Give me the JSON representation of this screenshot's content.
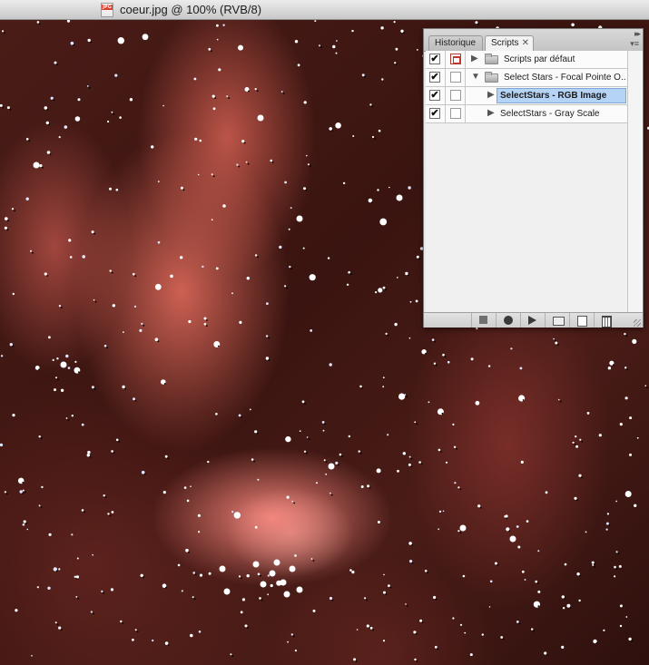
{
  "window": {
    "title": "coeur.jpg @ 100% (RVB/8)",
    "file_badge": "JPG"
  },
  "panel": {
    "tabs": [
      {
        "label": "Historique",
        "active": false
      },
      {
        "label": "Scripts",
        "active": true,
        "close_glyph": "✕"
      }
    ],
    "collapse_glyph": "▸▸",
    "menu_glyph": "▾≡",
    "rows": [
      {
        "label": "Scripts par défaut",
        "checked": true,
        "dialog": "red",
        "type": "folder",
        "expanded": false,
        "indent": 0,
        "selected": false
      },
      {
        "label": "Select Stars - Focal Pointe O...",
        "checked": true,
        "dialog": "empty",
        "type": "folder",
        "expanded": true,
        "indent": 0,
        "selected": false
      },
      {
        "label": "SelectStars - RGB Image",
        "checked": true,
        "dialog": "empty",
        "type": "action",
        "expanded": false,
        "indent": 1,
        "selected": true
      },
      {
        "label": "SelectStars - Gray Scale",
        "checked": true,
        "dialog": "empty",
        "type": "action",
        "expanded": false,
        "indent": 1,
        "selected": false
      }
    ],
    "check_glyph": "✔",
    "collapsed_arrow": "▶",
    "expanded_arrow": "▼",
    "toolbar": [
      {
        "name": "stop-button",
        "icon": "stop-icon"
      },
      {
        "name": "record-button",
        "icon": "record-icon"
      },
      {
        "name": "play-button",
        "icon": "play-icon"
      },
      {
        "name": "new-set-button",
        "icon": "folder-icon"
      },
      {
        "name": "new-action-button",
        "icon": "new-item-icon"
      },
      {
        "name": "delete-button",
        "icon": "trash-icon"
      }
    ]
  },
  "colors": {
    "selection": "#b5d3f5",
    "nebula": "#e87060",
    "background": "#3a1410"
  }
}
